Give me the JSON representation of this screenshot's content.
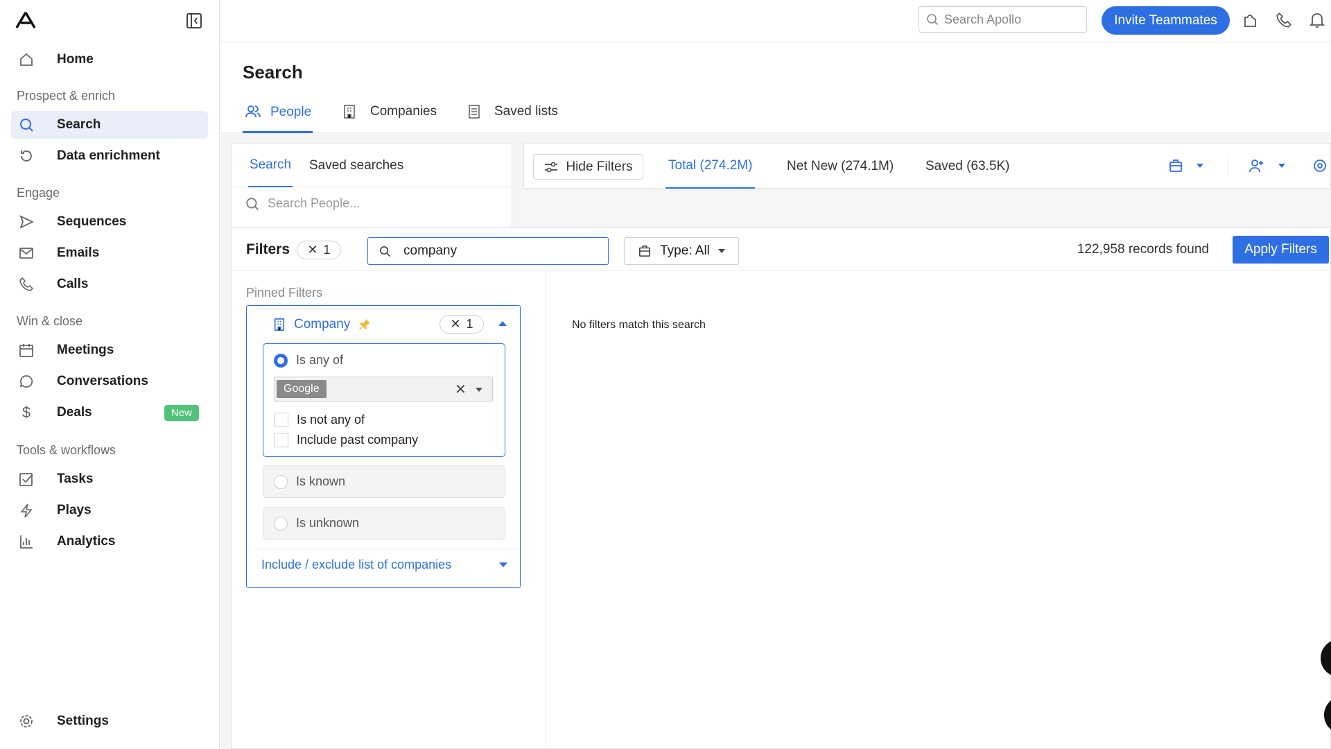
{
  "sidebar": {
    "items": [
      {
        "label": "Home",
        "icon": "home-icon"
      },
      {
        "section": "Prospect & enrich"
      },
      {
        "label": "Search",
        "icon": "search-icon",
        "active": true
      },
      {
        "label": "Data enrichment",
        "icon": "refresh-icon"
      },
      {
        "section": "Engage"
      },
      {
        "label": "Sequences",
        "icon": "send-icon"
      },
      {
        "label": "Emails",
        "icon": "mail-icon"
      },
      {
        "label": "Calls",
        "icon": "phone-icon"
      },
      {
        "section": "Win & close"
      },
      {
        "label": "Meetings",
        "icon": "calendar-icon"
      },
      {
        "label": "Conversations",
        "icon": "chat-icon"
      },
      {
        "label": "Deals",
        "icon": "dollar-icon",
        "badge": "New"
      },
      {
        "section": "Tools & workflows"
      },
      {
        "label": "Tasks",
        "icon": "checkbox-icon"
      },
      {
        "label": "Plays",
        "icon": "bolt-icon"
      },
      {
        "label": "Analytics",
        "icon": "bar-chart-icon"
      }
    ],
    "settings": "Settings",
    "badge_color": "#52c27a"
  },
  "topbar": {
    "search_placeholder": "Search Apollo",
    "invite": "Invite Teammates",
    "accent": "#2f6fe4"
  },
  "page": {
    "title": "Search",
    "tabs": [
      "People",
      "Companies",
      "Saved lists"
    ],
    "active_tab": "People"
  },
  "left_panel": {
    "tabs": [
      "Search",
      "Saved searches"
    ],
    "search_placeholder": "Search People..."
  },
  "results_bar": {
    "hide_filters": "Hide Filters",
    "tabs": [
      "Total (274.2M)",
      "Net New (274.1M)",
      "Saved (63.5K)"
    ]
  },
  "filters": {
    "title": "Filters",
    "count": "1",
    "search_value": "company",
    "type_label": "Type: All",
    "records": "122,958 records found",
    "apply": "Apply Filters",
    "no_match": "No filters match this search",
    "pinned_label": "Pinned Filters",
    "company": {
      "label": "Company",
      "count": "1",
      "any_of": "Is any of",
      "tag": "Google",
      "not_any_of": "Is not any of",
      "past": "Include past company",
      "known": "Is known",
      "unknown": "Is unknown",
      "include_exclude": "Include / exclude list of companies"
    }
  }
}
